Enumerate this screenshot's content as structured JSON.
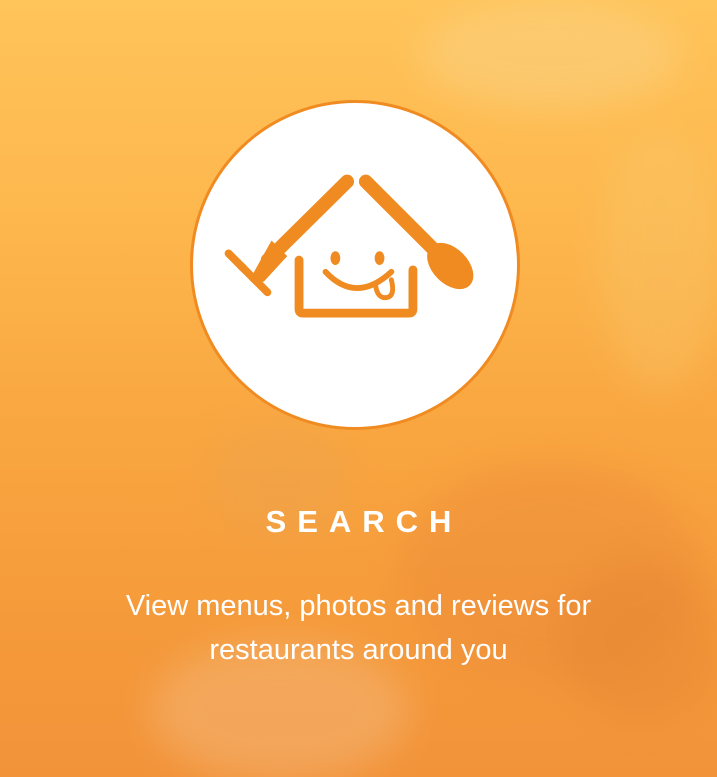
{
  "onboarding": {
    "logo_icon": "house-fork-spoon-smiley-icon",
    "title": "SEARCH",
    "description_line1": "View menus, photos and reviews for",
    "description_line2": "restaurants around you"
  },
  "colors": {
    "background_top": "#ffc45a",
    "background_bottom": "#f2933a",
    "logo_orange": "#f08b22",
    "circle": "#ffffff",
    "text": "#ffffff"
  }
}
